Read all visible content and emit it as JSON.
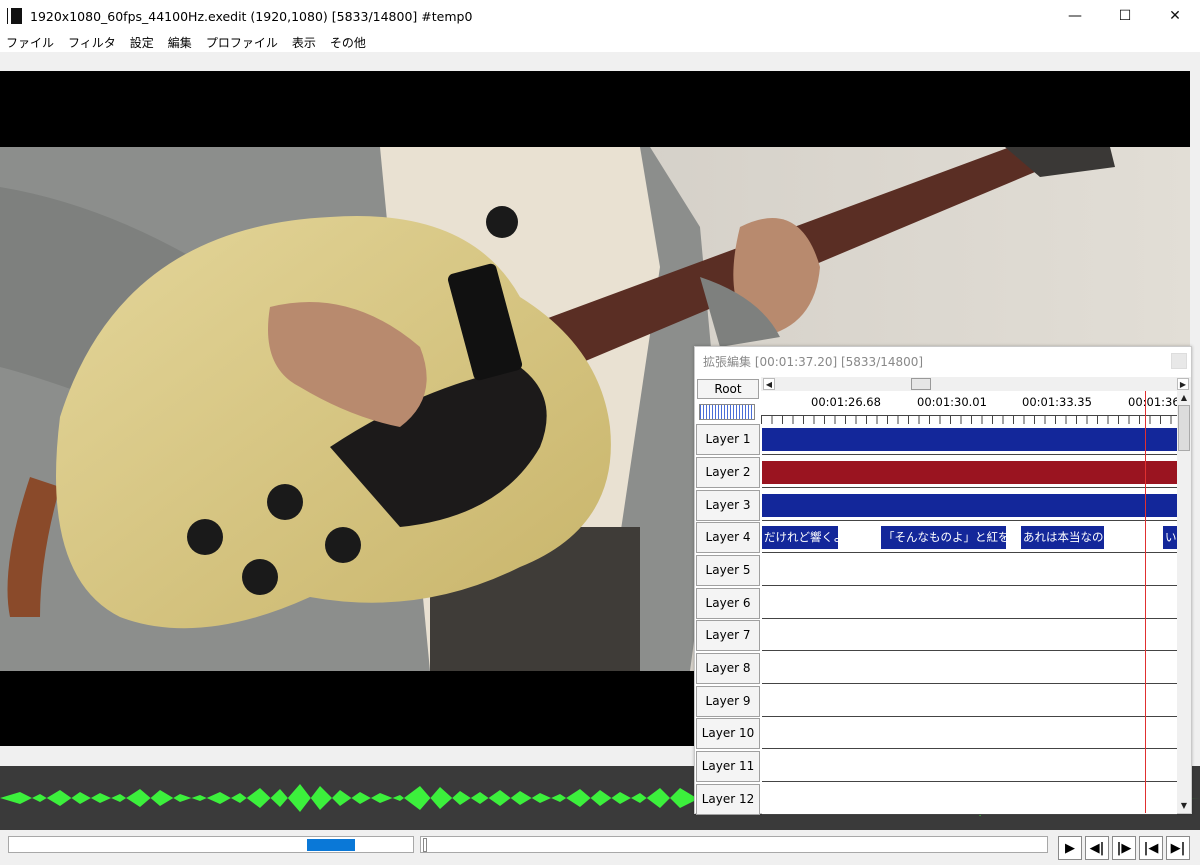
{
  "window": {
    "title": "1920x1080_60fps_44100Hz.exedit (1920,1080)  [5833/14800]  #temp0",
    "controls": {
      "minimize": "—",
      "maximize": "☐",
      "close": "✕"
    }
  },
  "menu": [
    "ファイル",
    "フィルタ",
    "設定",
    "編集",
    "プロファイル",
    "表示",
    "その他"
  ],
  "ext_edit": {
    "title": "拡張編集 [00:01:37.20] [5833/14800]",
    "root_label": "Root",
    "ruler_times": [
      "00:01:26.68",
      "00:01:30.01",
      "00:01:33.35",
      "00:01:36"
    ],
    "layers": [
      "Layer 1",
      "Layer 2",
      "Layer 3",
      "Layer 4",
      "Layer 5",
      "Layer 6",
      "Layer 7",
      "Layer 8",
      "Layer 9",
      "Layer 10",
      "Layer 11",
      "Layer 12"
    ],
    "layer4_clips": [
      "だけれど響くよ",
      "「そんなものよ」と紅を引い",
      "あれは本当なの",
      "い"
    ]
  },
  "playback": {
    "play": "▶",
    "prev_frame": "◀|",
    "next_frame": "|▶",
    "to_start": "|◀",
    "to_end": "▶|"
  },
  "colors": {
    "video_clip": "#13279a",
    "audio_clip": "#9a1420",
    "waveform": "#3cf03c",
    "cursor": "#e03030",
    "seek_thumb": "#0a78d7"
  }
}
